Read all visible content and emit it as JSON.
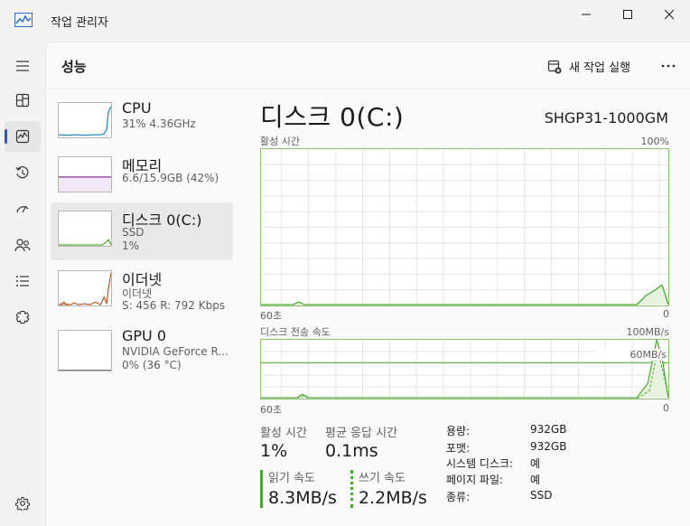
{
  "window": {
    "title": "작업 관리자",
    "controls": [
      "minimize",
      "maximize",
      "close"
    ]
  },
  "header": {
    "page_title": "성능",
    "new_task_label": "새 작업 실행",
    "more_label": "···"
  },
  "nav": {
    "items": [
      {
        "icon": "hamburger-icon"
      },
      {
        "icon": "processes-icon"
      },
      {
        "icon": "performance-icon",
        "active": true
      },
      {
        "icon": "app-history-icon"
      },
      {
        "icon": "startup-apps-icon"
      },
      {
        "icon": "users-icon"
      },
      {
        "icon": "details-icon"
      },
      {
        "icon": "services-icon"
      },
      {
        "icon": "settings-icon"
      }
    ]
  },
  "devices": [
    {
      "name": "CPU",
      "sub1": "31% 4.36GHz",
      "sub2": "",
      "color": "#1f8ac0"
    },
    {
      "name": "메모리",
      "sub1": "6.6/15.9GB (42%)",
      "sub2": "",
      "color": "#8b2aa8"
    },
    {
      "name": "디스크 0(C:)",
      "sub1": "SSD",
      "sub2": "1%",
      "color": "#4ca733",
      "selected": true
    },
    {
      "name": "이더넷",
      "sub1": "이더넷",
      "sub2": "S: 456 R: 792 Kbps",
      "color": "#b5541b"
    },
    {
      "name": "GPU 0",
      "sub1": "NVIDIA GeForce R...",
      "sub2": "0% (36 °C)",
      "color": "#7a7a7a"
    }
  ],
  "detail": {
    "title": "디스크 0(C:)",
    "model": "SHGP31-1000GM",
    "active_time_graph": {
      "label": "활성 시간",
      "max_label": "100%",
      "x_left": "60초",
      "x_right": "0"
    },
    "transfer_graph": {
      "label": "디스크 전송 속도",
      "max_label": "100MB/s",
      "ref_label": "60MB/s",
      "x_left": "60초",
      "x_right": "0"
    },
    "stats": {
      "active_time_label": "활성 시간",
      "active_time_value": "1%",
      "avg_response_label": "평균 응답 시간",
      "avg_response_value": "0.1ms",
      "read_speed_label": "읽기 속도",
      "read_speed_value": "8.3MB/s",
      "write_speed_label": "쓰기 속도",
      "write_speed_value": "2.2MB/s"
    },
    "info": [
      {
        "key": "용량:",
        "value": "932GB"
      },
      {
        "key": "포맷:",
        "value": "932GB"
      },
      {
        "key": "시스템 디스크:",
        "value": "예"
      },
      {
        "key": "페이지 파일:",
        "value": "예"
      },
      {
        "key": "종류:",
        "value": "SSD"
      }
    ]
  },
  "colors": {
    "disk_accent": "#4ca733",
    "grid": "#e4e4e4",
    "nav_active": "#1f5bd0"
  }
}
